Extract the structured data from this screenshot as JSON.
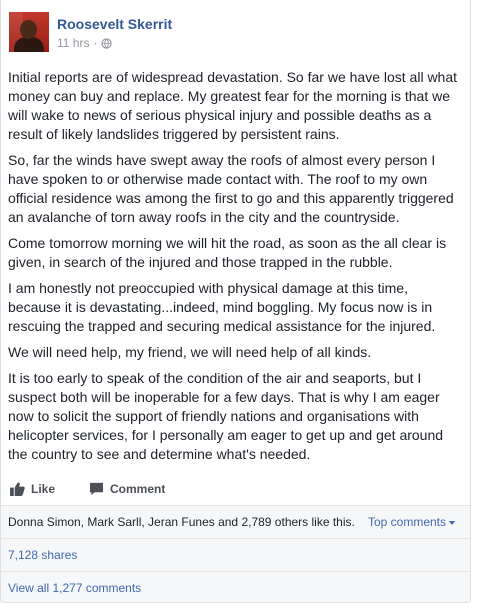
{
  "post": {
    "author": "Roosevelt Skerrit",
    "time": "11 hrs",
    "separator": "·",
    "paragraphs": [
      "Initial reports are of widespread devastation. So far we have lost all what money can buy and replace. My greatest fear for the morning is that we will wake to news of serious physical injury and possible deaths as a result of likely landslides triggered by persistent rains.",
      "So, far the winds have swept away the roofs of almost every person I have spoken to or otherwise made contact with. The roof to my own official residence was among the first to go and this apparently triggered an avalanche of torn away roofs in the city and the countryside.",
      "Come tomorrow morning we will hit the road, as soon as the all clear is given, in search of the injured and those trapped in the rubble.",
      "I am honestly not preoccupied with physical damage at this time, because it is devastating...indeed, mind boggling. My focus now is in rescuing the trapped and securing medical assistance for the injured.",
      "We will need help, my friend, we will need help of all kinds.",
      "It is too early to speak of the condition of the air and seaports, but I suspect both will be inoperable for a few days. That is why I am eager now to solicit the support of friendly nations and organisations with helicopter services, for I personally am eager to get up and get around the country to see and determine what's needed."
    ]
  },
  "actions": {
    "like": "Like",
    "comment": "Comment"
  },
  "feedback": {
    "likes": "Donna Simon, Mark Sarll, Jeran Funes and 2,789 others like this.",
    "top_comments": "Top comments",
    "shares": "7,128 shares",
    "view_comments": "View all 1,277 comments"
  },
  "icons": {
    "audience": "globe-icon",
    "like": "thumbs-up-icon",
    "comment": "speech-bubble-icon",
    "dropdown": "caret-down-icon"
  },
  "colors": {
    "link": "#365899",
    "accent": "#4267b2",
    "muted": "#90949c",
    "feedback_bg": "#f6f7f9"
  }
}
